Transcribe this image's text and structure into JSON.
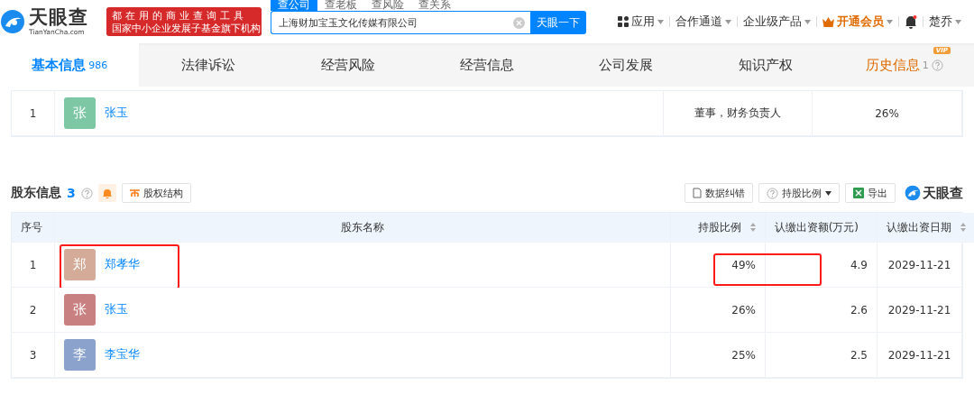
{
  "header": {
    "logo_name": "天眼查",
    "logo_domain": "TianYanCha.com",
    "slogan_lines": [
      "都在用的商业查询工具",
      "国家中小企业发展子基金旗下机构"
    ],
    "search_tabs": [
      {
        "label": "查公司",
        "selected": true
      },
      {
        "label": "查老板",
        "selected": false
      },
      {
        "label": "查风险",
        "selected": false
      },
      {
        "label": "查关系",
        "selected": false
      }
    ],
    "search_value": "上海财加宝玉文化传媒有限公司",
    "search_button": "天眼一下",
    "menu": [
      {
        "kind": "apps",
        "label": "应用"
      },
      {
        "kind": "plain",
        "label": "合作通道"
      },
      {
        "kind": "plain",
        "label": "企业级产品"
      },
      {
        "kind": "vip",
        "label": "开通会员"
      },
      {
        "kind": "bell"
      },
      {
        "kind": "plain",
        "label": "楚乔"
      }
    ]
  },
  "nav_tabs": [
    {
      "label": "基本信息",
      "count": "986",
      "selected": true,
      "vip": false
    },
    {
      "label": "法律诉讼",
      "selected": false,
      "vip": false
    },
    {
      "label": "经营风险",
      "selected": false,
      "vip": false
    },
    {
      "label": "经营信息",
      "selected": false,
      "vip": false
    },
    {
      "label": "公司发展",
      "selected": false,
      "vip": false
    },
    {
      "label": "知识产权",
      "selected": false,
      "vip": false
    },
    {
      "label": "历史信息",
      "count": "1",
      "selected": false,
      "vip": true,
      "vip_badge": "VIP"
    }
  ],
  "staff_rows": [
    {
      "index": "1",
      "avatar": "张",
      "color": "#7ec7a5",
      "name": "张玉",
      "position": "董事，财务负责人",
      "ratio": "26%"
    }
  ],
  "shareholders": {
    "title": "股东信息",
    "count": "3",
    "structure_button": "股权结构",
    "actions": [
      {
        "kind": "correct",
        "label": "数据纠错"
      },
      {
        "kind": "ratio",
        "label": "持股比例"
      },
      {
        "kind": "export",
        "label": "导出"
      }
    ],
    "brand": "天眼查",
    "columns": [
      "序号",
      "股东名称",
      "持股比例",
      "认缴出资额(万元)",
      "认缴出资日期"
    ],
    "rows": [
      {
        "index": "1",
        "avatar": "郑",
        "color": "#d3ab98",
        "name": "郑孝华",
        "ratio": "49%",
        "amount": "4.9",
        "date": "2029-11-21",
        "marked": true
      },
      {
        "index": "2",
        "avatar": "张",
        "color": "#c98080",
        "name": "张玉",
        "ratio": "26%",
        "amount": "2.6",
        "date": "2029-11-21",
        "marked": false
      },
      {
        "index": "3",
        "avatar": "李",
        "color": "#8aa2cc",
        "name": "李宝华",
        "ratio": "25%",
        "amount": "2.5",
        "date": "2029-11-21",
        "marked": false
      }
    ]
  }
}
